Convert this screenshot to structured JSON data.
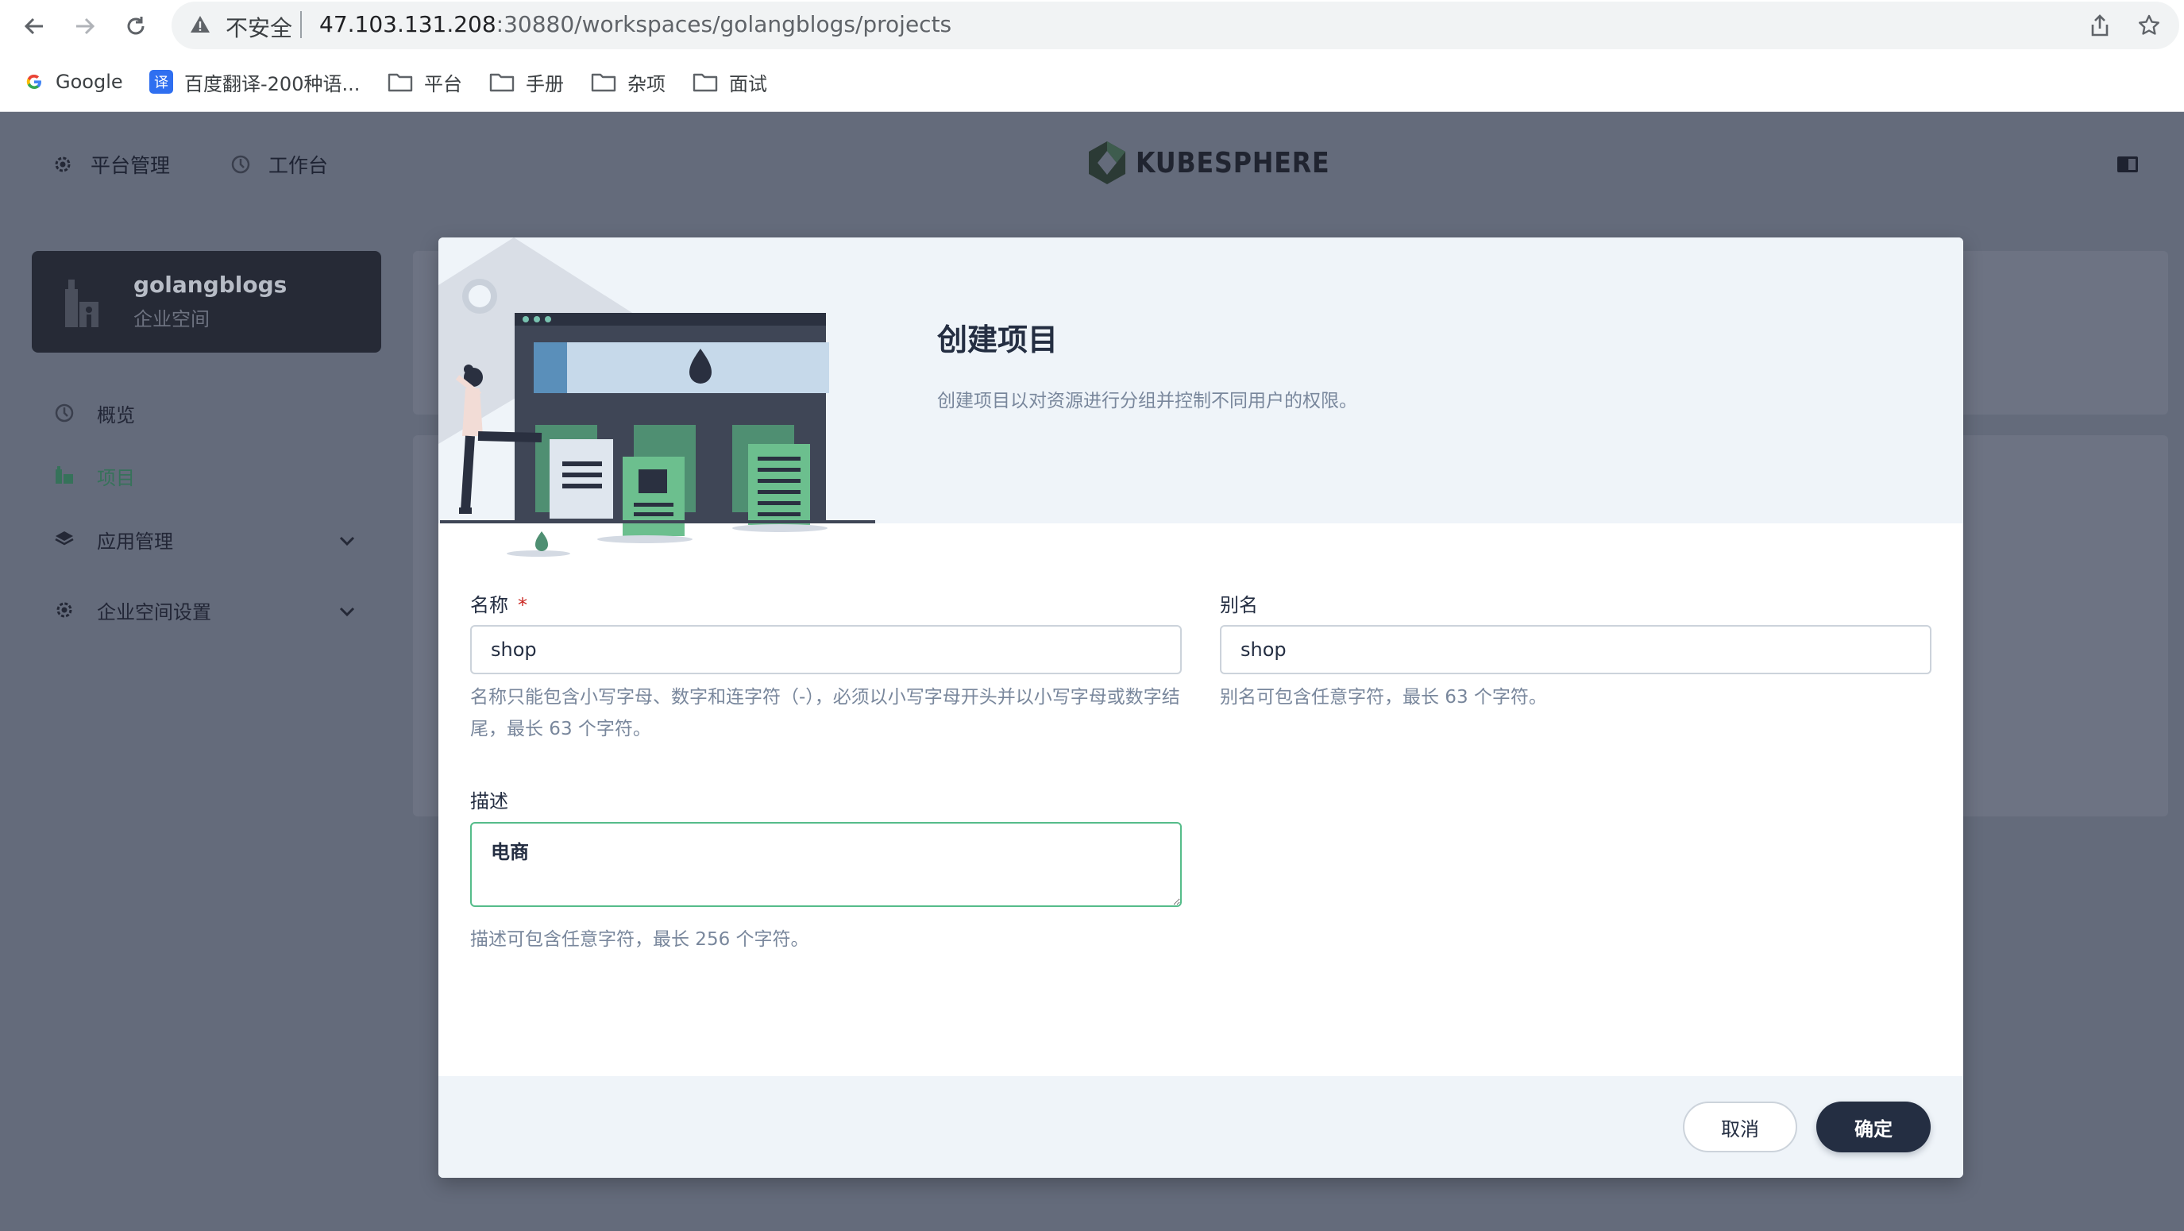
{
  "browser": {
    "security_label": "不安全",
    "url_host": "47.103.131.208",
    "url_rest": ":30880/workspaces/golangblogs/projects",
    "bookmarks": [
      {
        "label": "Google",
        "icon": "google-icon"
      },
      {
        "label": "百度翻译-200种语...",
        "icon": "translate-icon"
      },
      {
        "label": "平台",
        "icon": "folder-icon"
      },
      {
        "label": "手册",
        "icon": "folder-icon"
      },
      {
        "label": "杂项",
        "icon": "folder-icon"
      },
      {
        "label": "面试",
        "icon": "folder-icon"
      }
    ]
  },
  "header": {
    "platform_label": "平台管理",
    "workbench_label": "工作台",
    "logo_text": "KUBESPHERE"
  },
  "sidebar": {
    "workspace_name": "golangblogs",
    "workspace_type": "企业空间",
    "items": [
      {
        "label": "概览",
        "icon": "overview-icon"
      },
      {
        "label": "项目",
        "icon": "project-icon",
        "active": true
      },
      {
        "label": "应用管理",
        "icon": "app-management-icon"
      },
      {
        "label": "企业空间设置",
        "icon": "settings-icon"
      }
    ]
  },
  "modal": {
    "title": "创建项目",
    "description": "创建项目以对资源进行分组并控制不同用户的权限。",
    "name_label": "名称",
    "name_required_mark": "*",
    "name_value": "shop",
    "name_help": "名称只能包含小写字母、数字和连字符（-），必须以小写字母开头并以小写字母或数字结尾，最长 63 个字符。",
    "alias_label": "别名",
    "alias_value": "shop",
    "alias_help": "别名可包含任意字符，最长 63 个字符。",
    "desc_label": "描述",
    "desc_value": "电商",
    "desc_help": "描述可包含任意字符，最长 256 个字符。",
    "cancel_label": "取消",
    "ok_label": "确定"
  },
  "colors": {
    "overlay": "#646b7b",
    "primary_dark": "#242e42",
    "accent_green": "#55bc8a",
    "required_red": "#ca2621",
    "muted_text": "#79879c"
  }
}
